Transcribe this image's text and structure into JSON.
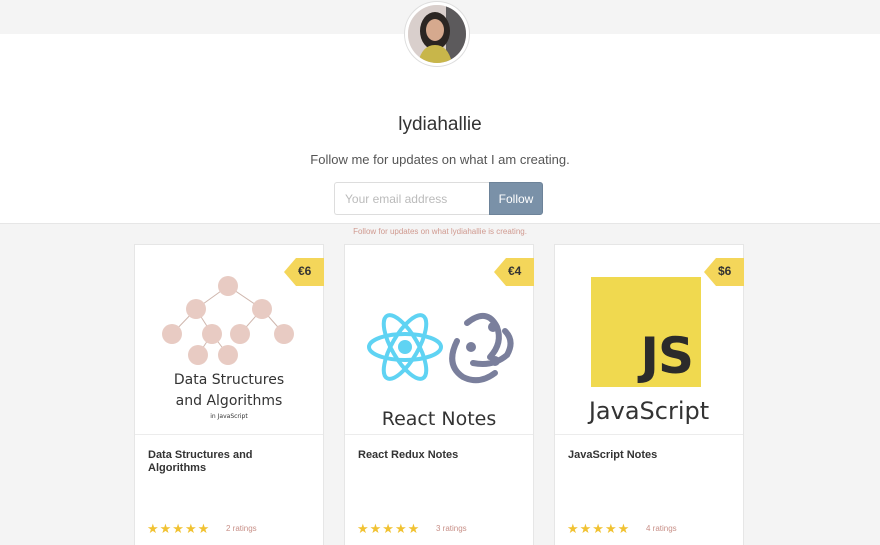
{
  "profile": {
    "username": "lydiahallie",
    "tagline": "Follow me for updates on what I am creating.",
    "avatar_icon": "avatar-photo"
  },
  "subscribe": {
    "email_placeholder": "Your email address",
    "email_value": "",
    "button_label": "Follow",
    "note": "Follow for updates on what lydiahallie is creating."
  },
  "products": [
    {
      "price": "€6",
      "cover_title_line1": "Data Structures",
      "cover_title_line2": "and Algorithms",
      "cover_subtitle": "in JavaScript",
      "title": "Data Structures and Algorithms",
      "stars": "★★★★★",
      "ratings": "2 ratings"
    },
    {
      "price": "€4",
      "cover_title": "React Notes",
      "title": "React Redux Notes",
      "stars": "★★★★★",
      "ratings": "3 ratings"
    },
    {
      "price": "$6",
      "cover_logo": "JS",
      "cover_title": "JavaScript",
      "title": "JavaScript Notes",
      "stars": "★★★★★",
      "ratings": "4 ratings"
    }
  ],
  "colors": {
    "accent": "#7a91a8",
    "price_tag": "#f4d65a",
    "star": "#f1c232",
    "react": "#5fd3f3",
    "redux": "#7a7f9c",
    "js_yellow": "#f0d94f",
    "tree_node": "#e8cbc3"
  }
}
